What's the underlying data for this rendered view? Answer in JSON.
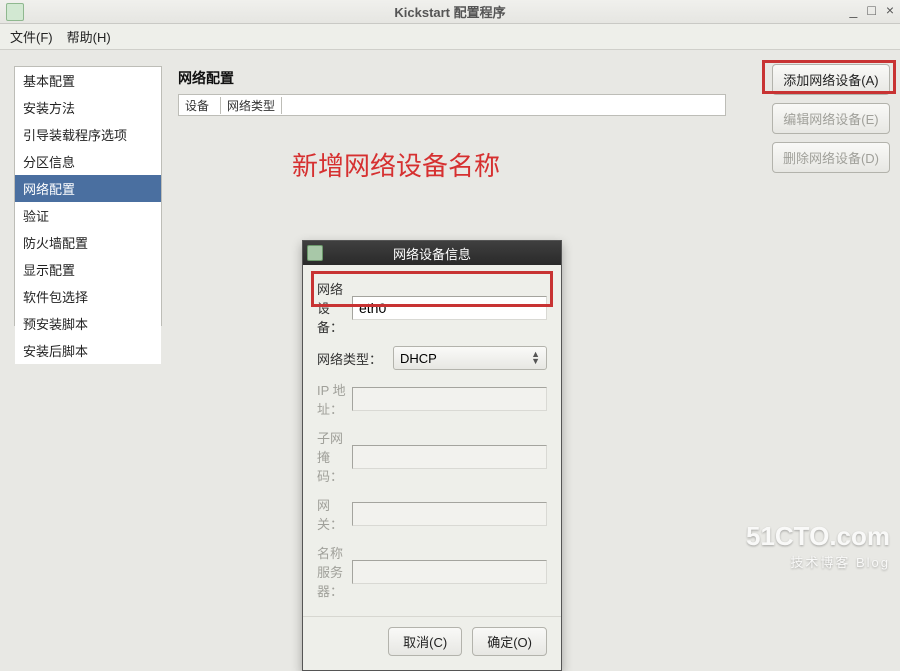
{
  "window": {
    "title": "Kickstart 配置程序",
    "minimize_icon": "_",
    "maximize_icon": "□",
    "close_icon": "×"
  },
  "menu": {
    "file": "文件(F)",
    "help": "帮助(H)"
  },
  "sidebar": {
    "items": [
      {
        "label": "基本配置"
      },
      {
        "label": "安装方法"
      },
      {
        "label": "引导装载程序选项"
      },
      {
        "label": "分区信息"
      },
      {
        "label": "网络配置"
      },
      {
        "label": "验证"
      },
      {
        "label": "防火墙配置"
      },
      {
        "label": "显示配置"
      },
      {
        "label": "软件包选择"
      },
      {
        "label": "预安装脚本"
      },
      {
        "label": "安装后脚本"
      }
    ],
    "selected_index": 4
  },
  "main": {
    "section_title": "网络配置",
    "table": {
      "col_device": "设备",
      "col_type": "网络类型"
    },
    "annotation": "新增网络设备名称",
    "buttons": {
      "add": "添加网络设备(A)",
      "edit": "编辑网络设备(E)",
      "delete": "删除网络设备(D)"
    }
  },
  "dialog": {
    "title": "网络设备信息",
    "fields": {
      "device_label": "网络设备：",
      "device_value": "eth0",
      "type_label": "网络类型：",
      "type_value": "DHCP",
      "ip_label": "IP 地址：",
      "netmask_label": "子网掩码：",
      "gateway_label": "网关：",
      "nameserver_label": "名称服务器："
    },
    "buttons": {
      "cancel": "取消(C)",
      "ok": "确定(O)"
    }
  },
  "watermark": {
    "main": "51CTO.com",
    "sub": "技术博客    Blog"
  }
}
